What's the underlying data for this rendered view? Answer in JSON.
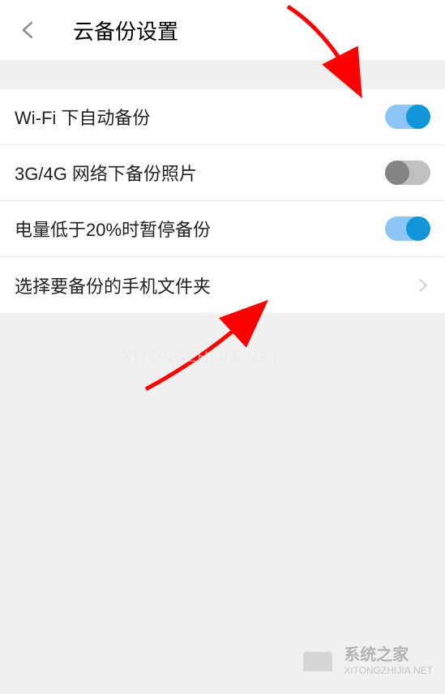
{
  "header": {
    "title": "云备份设置"
  },
  "settings": [
    {
      "label": "Wi-Fi 下自动备份",
      "type": "toggle",
      "enabled": true
    },
    {
      "label": "3G/4G 网络下备份照片",
      "type": "toggle",
      "enabled": false
    },
    {
      "label": "电量低于20%时暂停备份",
      "type": "toggle",
      "enabled": true
    },
    {
      "label": "选择要备份的手机文件夹",
      "type": "navigate"
    }
  ],
  "watermark": {
    "title": "系统之家",
    "url": "XITONGZHIJIA.NET"
  }
}
